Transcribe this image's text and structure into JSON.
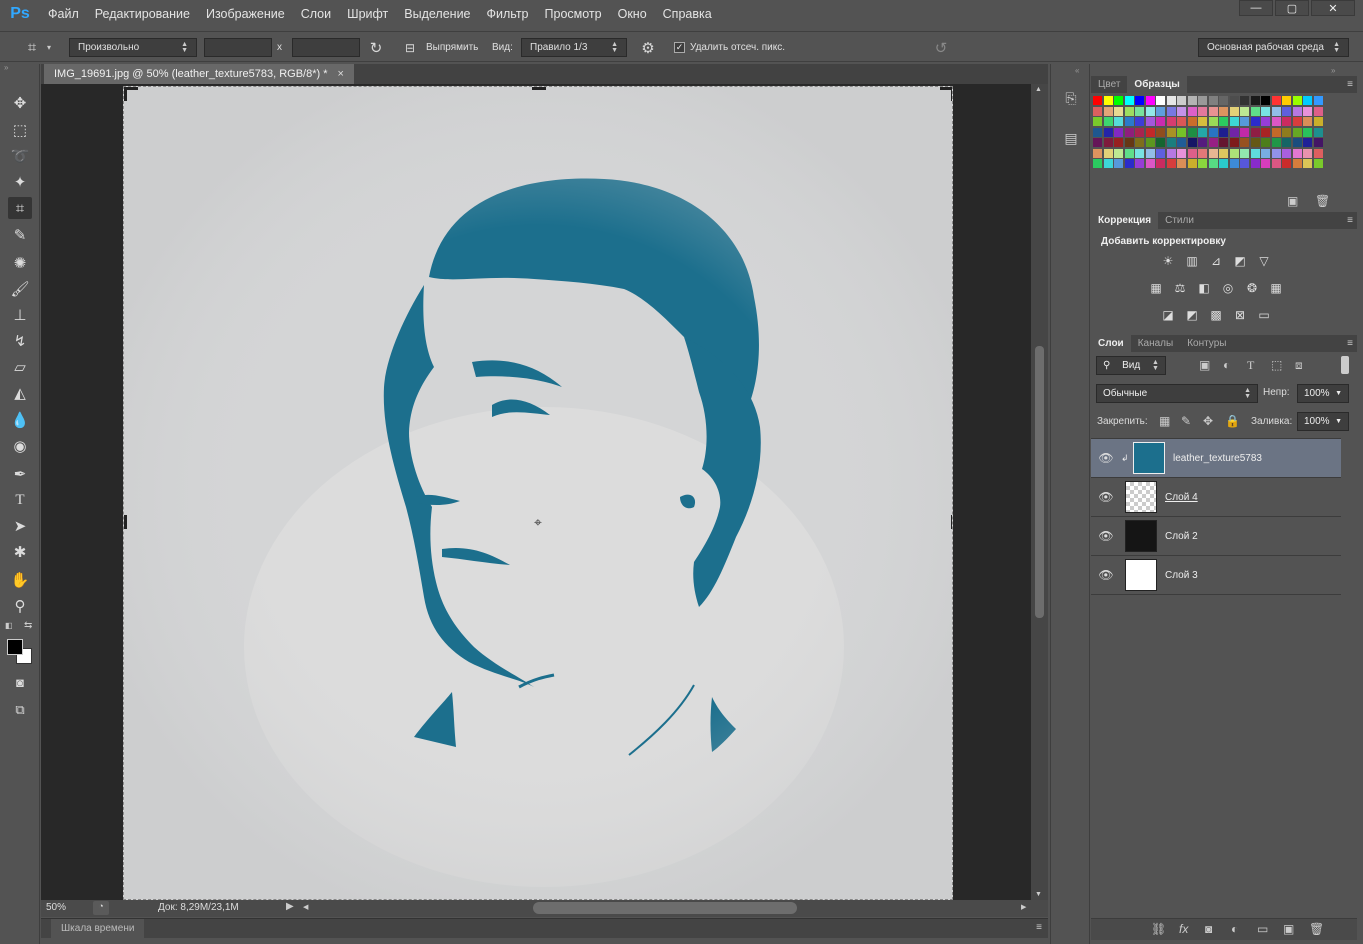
{
  "app": {
    "logo": "Ps"
  },
  "menu": [
    "Файл",
    "Редактирование",
    "Изображение",
    "Слои",
    "Шрифт",
    "Выделение",
    "Фильтр",
    "Просмотр",
    "Окно",
    "Справка"
  ],
  "window_controls": {
    "minimize": "—",
    "maximize": "▢",
    "close": "✕"
  },
  "options": {
    "ratio_select": "Произвольно",
    "multiply": "x",
    "straighten_label": "Выпрямить",
    "view_label": "Вид:",
    "view_select": "Правило 1/3",
    "delete_crop_label": "Удалить отсеч. пикс.",
    "delete_crop_checked": true,
    "workspace_select": "Основная рабочая среда"
  },
  "document": {
    "tab_title": "IMG_19691.jpg @ 50% (leather_texture5783, RGB/8*) *",
    "tab_close": "×",
    "zoom": "50%",
    "doc_info": "Док: 8,29M/23,1M",
    "timeline_label": "Шкала времени"
  },
  "colors": {
    "accent": "#31a8ff",
    "panel_bg": "#535353",
    "canvas_bg": "#d4d5d6",
    "silhouette": "#1c6f8d",
    "selected_layer": "#6b7484"
  },
  "swatches_panel": {
    "tabs": [
      "Цвет",
      "Образцы"
    ],
    "active_tab": "Образцы"
  },
  "adjustments_panel": {
    "tabs": [
      "Коррекция",
      "Стили"
    ],
    "active_tab": "Коррекция",
    "title": "Добавить корректировку"
  },
  "layers_panel": {
    "tabs": [
      "Слои",
      "Каналы",
      "Контуры"
    ],
    "active_tab": "Слои",
    "filter_label": "Вид",
    "blend_mode": "Обычные",
    "opacity_label": "Непр:",
    "opacity_value": "100%",
    "lock_label": "Закрепить:",
    "fill_label": "Заливка:",
    "fill_value": "100%",
    "layers": [
      {
        "name": "leather_texture5783",
        "selected": true,
        "thumb": "texture"
      },
      {
        "name": "Слой 4",
        "selected": false,
        "thumb": "portrait"
      },
      {
        "name": "Слой 2",
        "selected": false,
        "thumb": "dark"
      },
      {
        "name": "Слой 3",
        "selected": false,
        "thumb": "white"
      }
    ]
  },
  "icons": [
    "move-icon",
    "marquee-icon",
    "lasso-icon",
    "magic-wand-icon",
    "crop-icon",
    "eyedropper-icon",
    "healing-brush-icon",
    "brush-icon",
    "clone-stamp-icon",
    "history-brush-icon",
    "eraser-icon",
    "paint-bucket-icon",
    "blur-icon",
    "dodge-icon",
    "pen-icon",
    "type-icon",
    "path-selection-icon",
    "custom-shape-icon",
    "hand-icon",
    "zoom-icon"
  ]
}
